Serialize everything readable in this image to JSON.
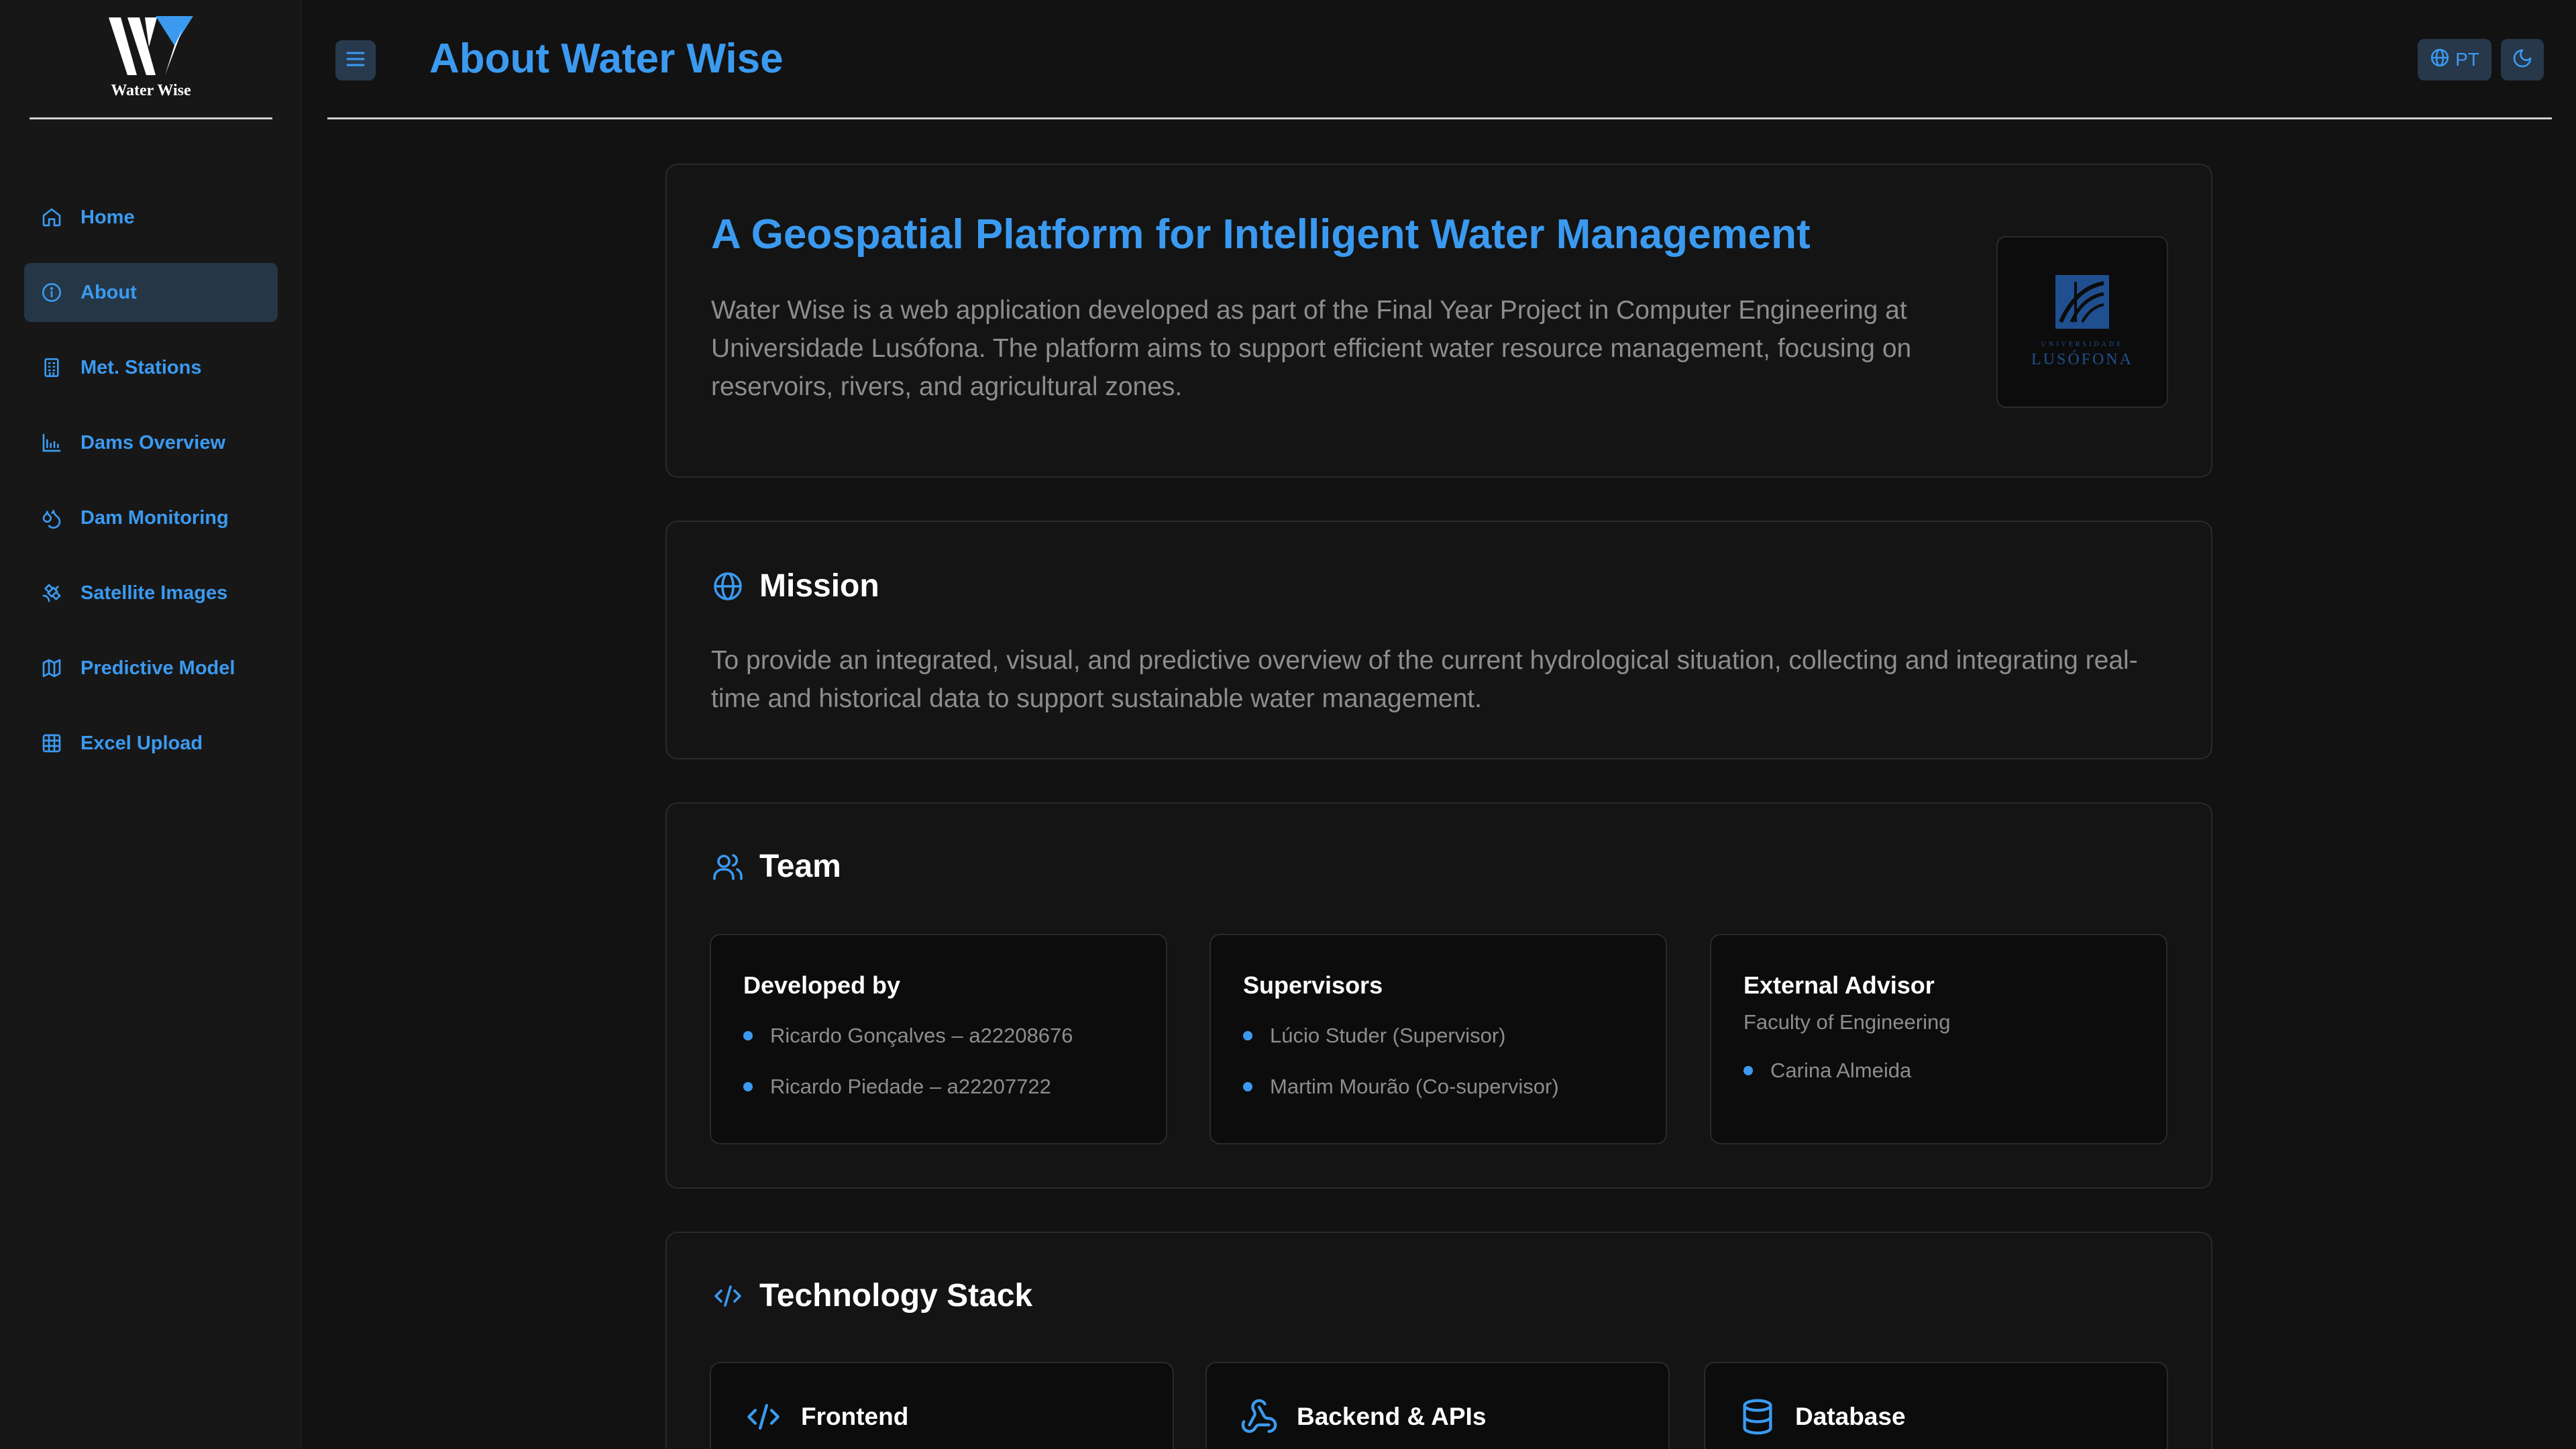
{
  "app": {
    "name": "Water Wise"
  },
  "sidebar": {
    "items": [
      {
        "label": "Home",
        "icon": "home-icon"
      },
      {
        "label": "About",
        "icon": "info-icon",
        "active": true
      },
      {
        "label": "Met. Stations",
        "icon": "building-icon"
      },
      {
        "label": "Dams Overview",
        "icon": "dam-chart-icon"
      },
      {
        "label": "Dam Monitoring",
        "icon": "droplets-icon"
      },
      {
        "label": "Satellite Images",
        "icon": "satellite-icon"
      },
      {
        "label": "Predictive Model",
        "icon": "map-icon"
      },
      {
        "label": "Excel Upload",
        "icon": "table-icon"
      }
    ]
  },
  "header": {
    "title": "About Water Wise",
    "lang_label": "PT"
  },
  "hero": {
    "title": "A Geospatial Platform for Intelligent Water Management",
    "text": "Water Wise is a web application developed as part of the Final Year Project in Computer Engineering at Universidade Lusófona. The platform aims to support efficient water resource management, focusing on reservoirs, rivers, and agricultural zones.",
    "logo_small": "UNIVERSIDADE",
    "logo_big": "LUSÓFONA"
  },
  "mission": {
    "title": "Mission",
    "text": "To provide an integrated, visual, and predictive overview of the current hydrological situation, collecting and integrating real-time and historical data to support sustainable water management."
  },
  "team": {
    "title": "Team",
    "developed": {
      "title": "Developed by",
      "members": [
        "Ricardo Gonçalves – a22208676",
        "Ricardo Piedade – a22207722"
      ]
    },
    "supervisors": {
      "title": "Supervisors",
      "members": [
        "Lúcio Studer (Supervisor)",
        "Martim Mourão (Co-supervisor)"
      ]
    },
    "advisor": {
      "title": "External Advisor",
      "subtitle": "Faculty of Engineering",
      "members": [
        "Carina Almeida"
      ]
    }
  },
  "tech": {
    "title": "Technology Stack",
    "frontend": "Frontend",
    "backend": "Backend & APIs",
    "database": "Database"
  },
  "colors": {
    "accent": "#3b9af0",
    "background": "#121212",
    "card": "#141414"
  }
}
